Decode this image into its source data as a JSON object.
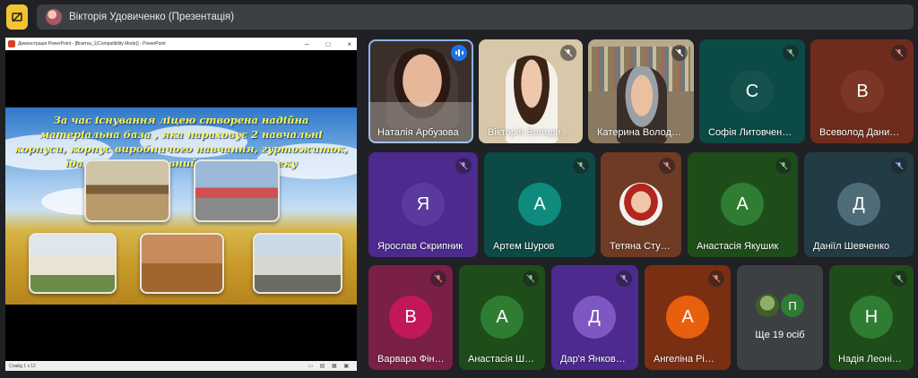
{
  "top_bar": {
    "presenter_label": "Вікторія Удовиченко (Презентація)"
  },
  "presentation": {
    "window_title": "Демонстрація PowerPoint - [Візитка_1(Compatibility Mode)] - PowerPoint",
    "slide_text": "За час існування ліцею створена  надійна матеріальна база , яка нараховує 2 навчальні корпуси, корпус виробничого навчання, гуртожиток, їдальню, спортивний зал, бібліотеку",
    "status_slide": "Слайд 1 з 12"
  },
  "participants": [
    {
      "name": "Наталія Арбузова",
      "type": "video",
      "speaking": true
    },
    {
      "name": "Вікторія Володи…",
      "type": "video",
      "muted": true
    },
    {
      "name": "Катерина Волод…",
      "type": "video",
      "muted": true
    },
    {
      "name": "Софія Литовчен…",
      "initial": "С",
      "bg": "#0b4a45",
      "circle": "#16524d",
      "mic_color": "#81c995",
      "muted": true
    },
    {
      "name": "Всеволод Дани…",
      "initial": "В",
      "bg": "#6f2c1c",
      "circle": "#7b3626",
      "mic_color": "#f28b82",
      "muted": true
    },
    {
      "name": "Ярослав Скрипник",
      "initial": "Я",
      "bg": "#4c2a8e",
      "circle": "#5a3a9c",
      "mic_color": "#c58af9",
      "muted": true
    },
    {
      "name": "Артем Шуров",
      "initial": "А",
      "bg": "#0b4a45",
      "circle": "#0e8b7d",
      "mic_color": "#81c995",
      "muted": true
    },
    {
      "name": "Тетяна Сту…",
      "type": "photo-avatar",
      "bg": "#6f3b24",
      "mic_color": "#f28b82",
      "muted": true
    },
    {
      "name": "Анастасія Якушик",
      "initial": "А",
      "bg": "#1e4d1a",
      "circle": "#2e7d32",
      "mic_color": "#81c995",
      "muted": true
    },
    {
      "name": "Даніїл Шевченко",
      "initial": "Д",
      "bg": "#233b45",
      "circle": "#4e6b78",
      "mic_color": "#8ab4f8",
      "muted": true
    },
    {
      "name": "Варвара Фін…",
      "initial": "В",
      "bg": "#7a1f45",
      "circle": "#c2185b",
      "mic_color": "#f28b82",
      "muted": true
    },
    {
      "name": "Анастасія Ш…",
      "initial": "А",
      "bg": "#1e4d1a",
      "circle": "#2e7d32",
      "mic_color": "#81c995",
      "muted": true
    },
    {
      "name": "Дар'я Янков…",
      "initial": "Д",
      "bg": "#4c2a8e",
      "circle": "#7e57c2",
      "mic_color": "#c58af9",
      "muted": true
    },
    {
      "name": "Ангеліна Рі…",
      "initial": "А",
      "bg": "#7a2f12",
      "circle": "#e8600c",
      "mic_color": "#f28b82",
      "muted": true
    },
    {
      "name": "Ще 19 осіб",
      "type": "more",
      "bg": "#3c4043",
      "circle_letter": "П"
    },
    {
      "name": "Надія Леоні…",
      "initial": "Н",
      "bg": "#1e4d1a",
      "circle": "#2e7d32",
      "mic_color": "#81c995",
      "muted": true
    }
  ],
  "colors": {
    "background": "#202124",
    "accent_yellow": "#f4c430",
    "active_speaker": "#8ab4f8"
  }
}
